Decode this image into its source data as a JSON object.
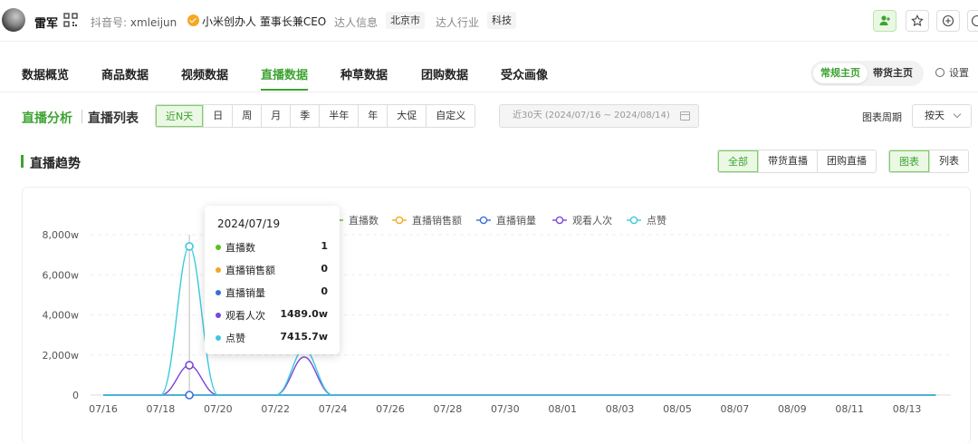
{
  "profile": {
    "name": "雷军",
    "douyin_label": "抖音号:",
    "douyin_id": "xmleijun",
    "verified_title": "小米创办人 董事长兼CEO",
    "info_label": "达人信息",
    "city": "北京市",
    "industry_label": "达人行业",
    "industry": "科技"
  },
  "nav_tabs": [
    "数据概览",
    "商品数据",
    "视频数据",
    "直播数据",
    "种草数据",
    "团购数据",
    "受众画像"
  ],
  "home_toggle": {
    "regular": "常规主页",
    "goods": "带货主页"
  },
  "settings_label": "设置",
  "section": {
    "live_analysis": "直播分析",
    "live_list": "直播列表"
  },
  "range_pills": [
    "近N天",
    "日",
    "周",
    "月",
    "季",
    "半年",
    "年",
    "大促",
    "自定义"
  ],
  "date_range": "近30天 (2024/07/16 ~ 2024/08/14)",
  "period": {
    "label": "图表周期",
    "value": "按天"
  },
  "trend_title": "直播趋势",
  "live_filter": [
    "全部",
    "带货直播",
    "团购直播"
  ],
  "view_toggle": [
    "图表",
    "列表"
  ],
  "tooltip": {
    "date": "2024/07/19",
    "rows": [
      {
        "label": "直播数",
        "value": "1",
        "color": "#52c41a"
      },
      {
        "label": "直播销售额",
        "value": "0",
        "color": "#f5a623"
      },
      {
        "label": "直播销量",
        "value": "0",
        "color": "#3b6fd8"
      },
      {
        "label": "观看人次",
        "value": "1489.0w",
        "color": "#7b46d9"
      },
      {
        "label": "点赞",
        "value": "7415.7w",
        "color": "#3cc9e0"
      }
    ]
  },
  "chart_data": {
    "type": "line",
    "x": [
      "07/16",
      "07/17",
      "07/18",
      "07/19",
      "07/20",
      "07/21",
      "07/22",
      "07/23",
      "07/24",
      "07/25",
      "07/26",
      "07/27",
      "07/28",
      "07/29",
      "07/30",
      "07/31",
      "08/01",
      "08/02",
      "08/03",
      "08/04",
      "08/05",
      "08/06",
      "08/07",
      "08/08",
      "08/09",
      "08/10",
      "08/11",
      "08/12",
      "08/13",
      "08/14"
    ],
    "x_tick_labels": [
      "07/16",
      "07/18",
      "07/20",
      "07/22",
      "07/24",
      "07/26",
      "07/28",
      "07/30",
      "08/01",
      "08/03",
      "08/05",
      "08/07",
      "08/09",
      "08/11",
      "08/13"
    ],
    "y_ticks": [
      "0",
      "2,000w",
      "4,000w",
      "6,000w",
      "8,000w"
    ],
    "ylim": [
      0,
      8000
    ],
    "y_unit": "w",
    "grid": true,
    "legend_position": "top",
    "series": [
      {
        "name": "直播数",
        "color": "#52c41a",
        "values": [
          0,
          0,
          0,
          0.0001,
          0,
          0,
          0,
          0.0001,
          0,
          0,
          0,
          0,
          0,
          0,
          0,
          0,
          0,
          0,
          0,
          0,
          0,
          0,
          0,
          0,
          0,
          0,
          0,
          0,
          0,
          0
        ]
      },
      {
        "name": "直播销售额",
        "color": "#f5a623",
        "values": [
          0,
          0,
          0,
          0,
          0,
          0,
          0,
          0,
          0,
          0,
          0,
          0,
          0,
          0,
          0,
          0,
          0,
          0,
          0,
          0,
          0,
          0,
          0,
          0,
          0,
          0,
          0,
          0,
          0,
          0
        ]
      },
      {
        "name": "直播销量",
        "color": "#3b6fd8",
        "values": [
          0,
          0,
          0,
          0,
          0,
          0,
          0,
          0,
          0,
          0,
          0,
          0,
          0,
          0,
          0,
          0,
          0,
          0,
          0,
          0,
          0,
          0,
          0,
          0,
          0,
          0,
          0,
          0,
          0,
          0
        ]
      },
      {
        "name": "观看人次",
        "color": "#7b46d9",
        "values": [
          0,
          0,
          0,
          1489.0,
          0,
          0,
          0,
          1900,
          0,
          0,
          0,
          0,
          0,
          0,
          0,
          0,
          0,
          0,
          0,
          0,
          0,
          0,
          0,
          0,
          0,
          0,
          0,
          0,
          0,
          0
        ]
      },
      {
        "name": "点赞",
        "color": "#3cc9e0",
        "values": [
          0,
          0,
          0,
          7415.7,
          0,
          0,
          0,
          2300,
          0,
          0,
          0,
          0,
          0,
          0,
          0,
          0,
          0,
          0,
          0,
          0,
          0,
          0,
          0,
          0,
          0,
          0,
          0,
          0,
          0,
          0
        ]
      }
    ]
  }
}
